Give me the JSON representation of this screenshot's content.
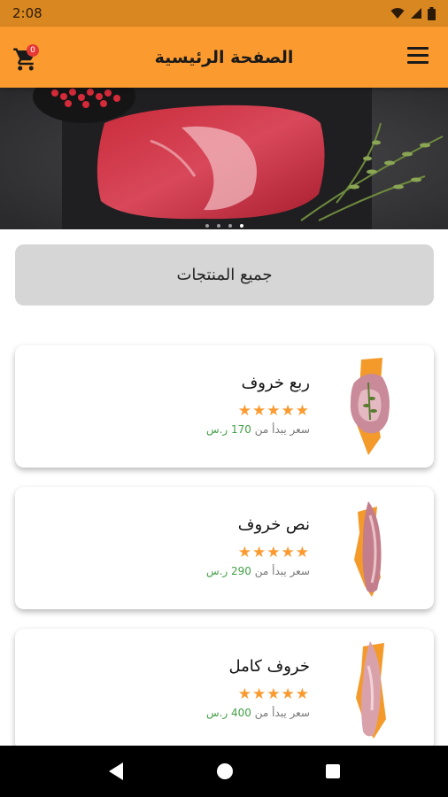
{
  "status_bar": {
    "time": "2:08",
    "icons": [
      "wifi-icon",
      "signal-icon",
      "battery-icon"
    ]
  },
  "app_bar": {
    "title": "الصفحة الرئيسية",
    "cart_count": "0",
    "background": "#fb9a2f"
  },
  "banner": {
    "image": "raw-meat-photo",
    "slide_count": 4,
    "active_slide": 4
  },
  "all_products_label": "جميع المنتجات",
  "products": [
    {
      "name": "ربع خروف",
      "rating": 5,
      "stars": "★★★★★",
      "price_prefix": "سعر يبدأ من ",
      "price": "170 ر.س"
    },
    {
      "name": "نص خروف",
      "rating": 5,
      "stars": "★★★★★",
      "price_prefix": "سعر يبدأ من ",
      "price": "290 ر.س"
    },
    {
      "name": "خروف كامل",
      "rating": 5,
      "stars": "★★★★★",
      "price_prefix": "سعر يبدأ من ",
      "price": "400 ر.س"
    }
  ],
  "colors": {
    "accent": "#fb9a2f",
    "price": "#43a047",
    "badge": "#e53935"
  },
  "nav_bar": {
    "icons": [
      "back-icon",
      "home-icon",
      "recents-icon"
    ]
  }
}
